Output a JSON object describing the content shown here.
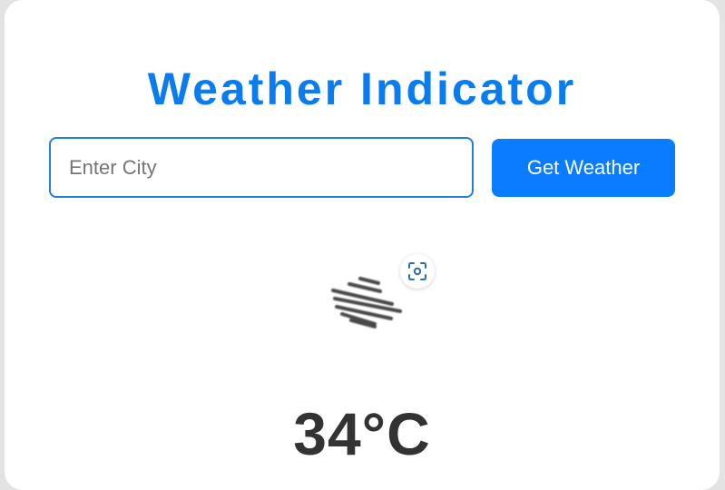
{
  "app": {
    "title": "Weather Indicator"
  },
  "search": {
    "placeholder": "Enter City",
    "value": "",
    "button_label": "Get Weather"
  },
  "weather": {
    "icon": "mist-icon",
    "temperature": "34°C"
  },
  "overlay": {
    "icon": "visual-search-lens-icon"
  },
  "colors": {
    "accent": "#0a7cff",
    "title": "#0a7cf0",
    "text": "#333333",
    "background": "#e3e3e3",
    "card": "#ffffff"
  }
}
